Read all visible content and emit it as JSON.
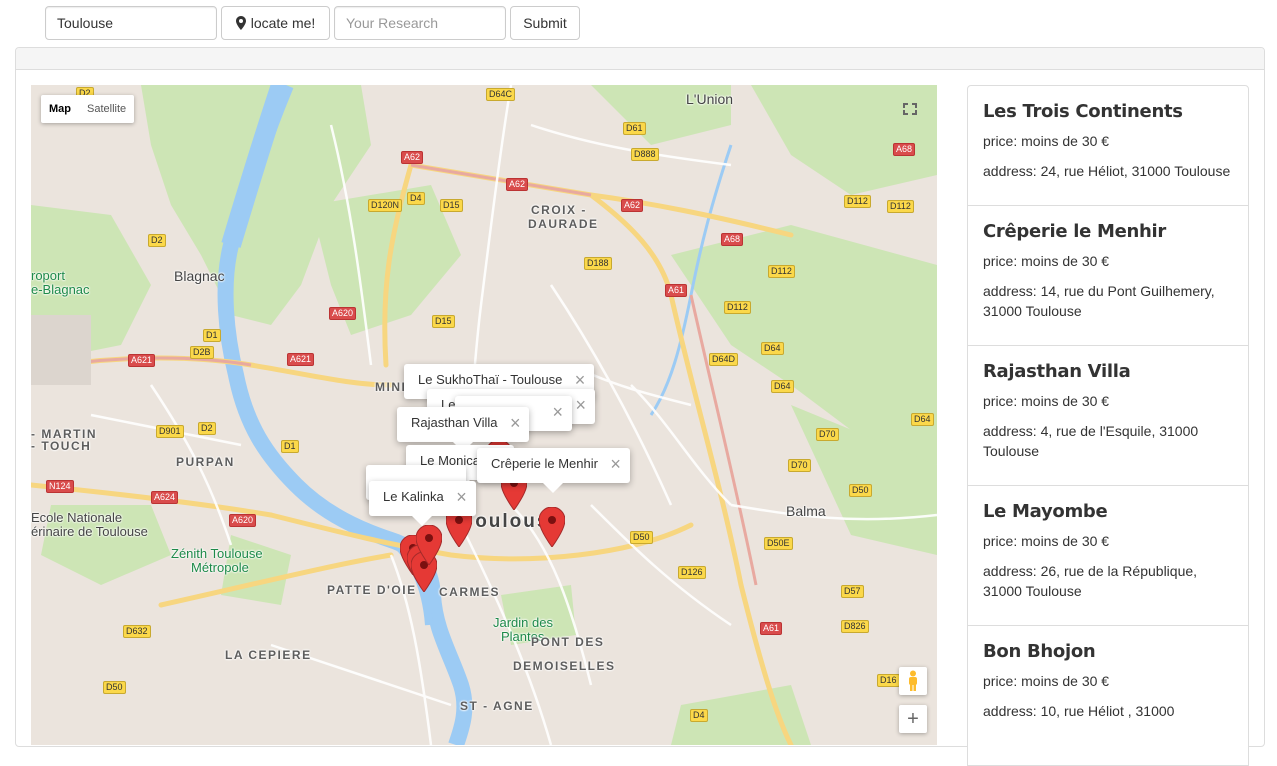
{
  "search": {
    "location_value": "Toulouse",
    "locate_label": "locate me!",
    "research_placeholder": "Your Research",
    "submit_label": "Submit"
  },
  "map": {
    "type_map": "Map",
    "type_satellite": "Satellite",
    "labels": {
      "lunion": "L'Union",
      "croix": "CROIX -",
      "daurade": "DAURADE",
      "blagnac": "Blagnac",
      "minimes": "MINI",
      "purpan": "PURPAN",
      "toulouse": "Toulouse",
      "martin": "- MARTIN",
      "touch": "- TOUCH",
      "aeroport": "roport",
      "blagnac2": "e-Blagnac",
      "ecole": "Ecole Nationale",
      "ecole2": "érinaire de Toulouse",
      "zenith": "Zénith Toulouse",
      "zenith2": "Métropole",
      "patte": "PATTE D'OIE",
      "carmes": "CARMES",
      "jardin": "Jardin des",
      "jardin2": "Plantes",
      "pont": "PONT DES",
      "pont2": "DEMOISELLES",
      "cepiere": "LA CEPIERE",
      "stagne": "ST - AGNE",
      "balma": "Balma"
    },
    "roads": [
      "D2",
      "D64C",
      "A62",
      "D61",
      "D888",
      "D4",
      "D120N",
      "D15",
      "A62",
      "A62",
      "A68",
      "D112",
      "D112",
      "D2",
      "D188",
      "A68",
      "D112",
      "A61",
      "D112",
      "D1",
      "D2B",
      "A620",
      "A621",
      "A621",
      "D15",
      "D64D",
      "D64",
      "D64",
      "D901",
      "D2",
      "D1",
      "D64",
      "D70",
      "D70",
      "N124",
      "A624",
      "D50",
      "A620",
      "D50",
      "D50E",
      "D126",
      "D57",
      "D632",
      "D50",
      "D826",
      "A61",
      "D16",
      "D4"
    ],
    "popups": [
      {
        "label": "Le SukhoThaï - Toulouse"
      },
      {
        "label": "Le Bon Bhojon"
      },
      {
        "label": "Rajasthan Villa"
      },
      {
        "label": "Le Monica"
      },
      {
        "label": "Crêperie le Menhir"
      },
      {
        "label": "Le Kalinka"
      }
    ]
  },
  "restaurants": [
    {
      "name": "Les Trois Continents",
      "price": "price: moins de 30 €",
      "address": "address: 24, rue Héliot, 31000 Toulouse"
    },
    {
      "name": "Crêperie le Menhir",
      "price": "price: moins de 30 €",
      "address": "address: 14, rue du Pont Guilhemery, 31000 Toulouse"
    },
    {
      "name": "Rajasthan Villa",
      "price": "price: moins de 30 €",
      "address": "address: 4, rue de l'Esquile, 31000 Toulouse"
    },
    {
      "name": "Le Mayombe",
      "price": "price: moins de 30 €",
      "address": "address: 26, rue de la République, 31000 Toulouse"
    },
    {
      "name": "Bon Bhojon",
      "price": "price: moins de 30 €",
      "address": "address: 10, rue Héliot , 31000"
    }
  ],
  "colors": {
    "pin": "#e53935",
    "river": "#9ccbf4",
    "park": "#cde5b5",
    "map_bg": "#ebe4dd"
  }
}
